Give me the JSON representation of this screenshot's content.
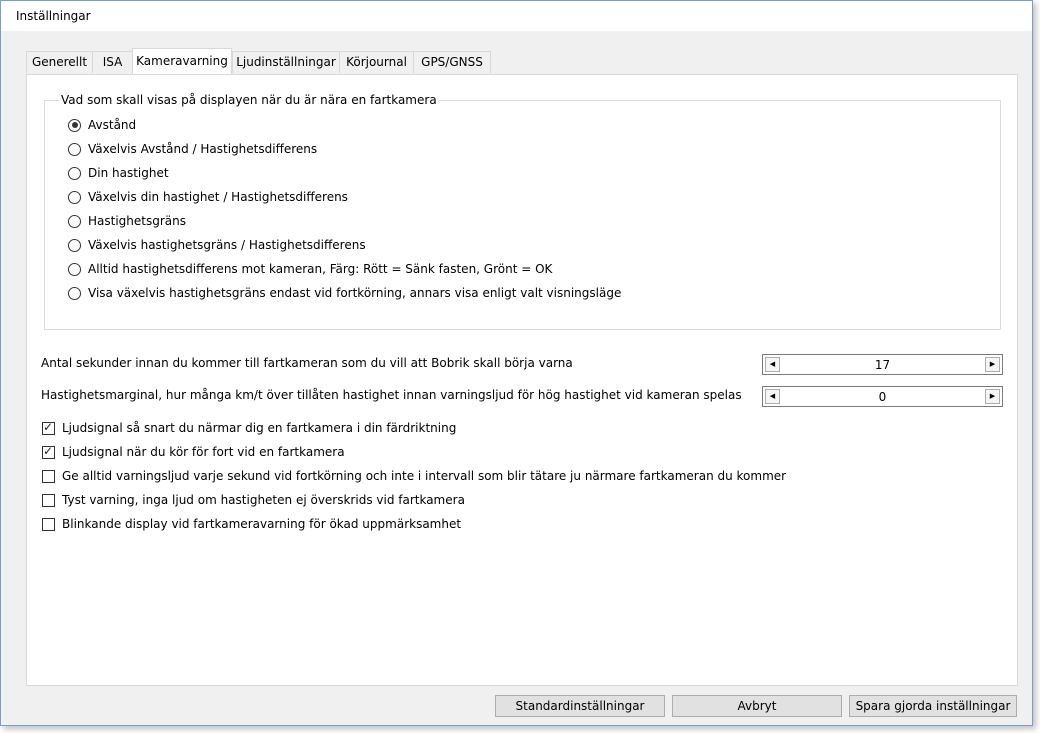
{
  "window": {
    "title": "Inställningar"
  },
  "tabs": [
    {
      "label": "Generellt",
      "active": false
    },
    {
      "label": "ISA",
      "active": false
    },
    {
      "label": "Kameravarning",
      "active": true
    },
    {
      "label": "Ljudinställningar",
      "active": false
    },
    {
      "label": "Körjournal",
      "active": false
    },
    {
      "label": "GPS/GNSS",
      "active": false
    }
  ],
  "display_group": {
    "legend": "Vad som skall visas på displayen när du är nära en fartkamera",
    "options": [
      {
        "label": "Avstånd",
        "selected": true
      },
      {
        "label": "Växelvis Avstånd / Hastighetsdifferens",
        "selected": false
      },
      {
        "label": "Din hastighet",
        "selected": false
      },
      {
        "label": "Växelvis din hastighet / Hastighetsdifferens",
        "selected": false
      },
      {
        "label": "Hastighetsgräns",
        "selected": false
      },
      {
        "label": "Växelvis hastighetsgräns / Hastighetsdifferens",
        "selected": false
      },
      {
        "label": "Alltid hastighetsdifferens mot kameran, Färg: Rött = Sänk fasten, Grönt = OK",
        "selected": false
      },
      {
        "label": "Visa växelvis hastighetsgräns endast vid fortkörning, annars visa enligt valt visningsläge",
        "selected": false
      }
    ]
  },
  "fields": {
    "warn_seconds": {
      "label": "Antal sekunder innan du kommer till fartkameran som du vill att Bobrik skall börja varna",
      "value": "17"
    },
    "speed_margin": {
      "label": "Hastighetsmarginal, hur många km/t över tillåten hastighet innan varningsljud för hög hastighet vid kameran spelas",
      "value": "0"
    }
  },
  "checkboxes": [
    {
      "label": "Ljudsignal så snart du närmar dig en fartkamera i din färdriktning",
      "checked": true
    },
    {
      "label": "Ljudsignal när du kör för fort vid en fartkamera",
      "checked": true
    },
    {
      "label": "Ge alltid varningsljud varje sekund vid fortkörning och inte i intervall som blir tätare ju närmare fartkameran du kommer",
      "checked": false
    },
    {
      "label": "Tyst varning, inga ljud om hastigheten ej överskrids vid fartkamera",
      "checked": false
    },
    {
      "label": "Blinkande display vid fartkameravarning för ökad uppmärksamhet",
      "checked": false
    }
  ],
  "buttons": {
    "defaults": "Standardinställningar",
    "cancel": "Avbryt",
    "save": "Spara gjorda inställningar"
  },
  "icons": {
    "spin_decrease": "left-arrow-icon",
    "spin_increase": "right-arrow-icon"
  },
  "colors": {
    "window_border": "#7a9ec9",
    "panel_background": "#ffffff",
    "dialog_background": "#f0f0f0",
    "button_background": "#e1e1e1"
  }
}
